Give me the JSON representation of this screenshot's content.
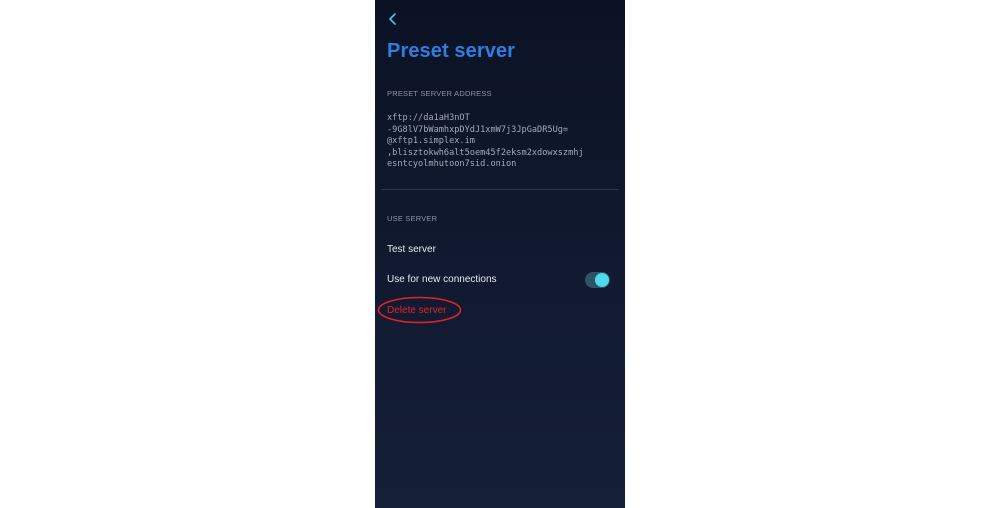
{
  "header": {
    "back_icon": "chevron-left-icon",
    "title": "Preset server"
  },
  "address_section": {
    "label": "PRESET SERVER ADDRESS",
    "lines": [
      "xftp://da1aH3nOT",
      "-9G8lV7bWamhxpDYdJ1xmW7j3JpGaDR5Ug=",
      "@xftp1.simplex.im",
      ",blisztokwh6alt5oem45f2eksm2xdowxszmhj",
      "esntcyolmhutoon7sid.onion"
    ]
  },
  "use_section": {
    "label": "USE SERVER",
    "test_server_label": "Test server",
    "use_new_connections_label": "Use for new connections",
    "use_new_connections_enabled": true,
    "delete_server_label": "Delete server"
  },
  "colors": {
    "title": "#2f7de1",
    "accent": "#4fd9ec",
    "danger": "#e0242a",
    "background": "#0b1224"
  }
}
